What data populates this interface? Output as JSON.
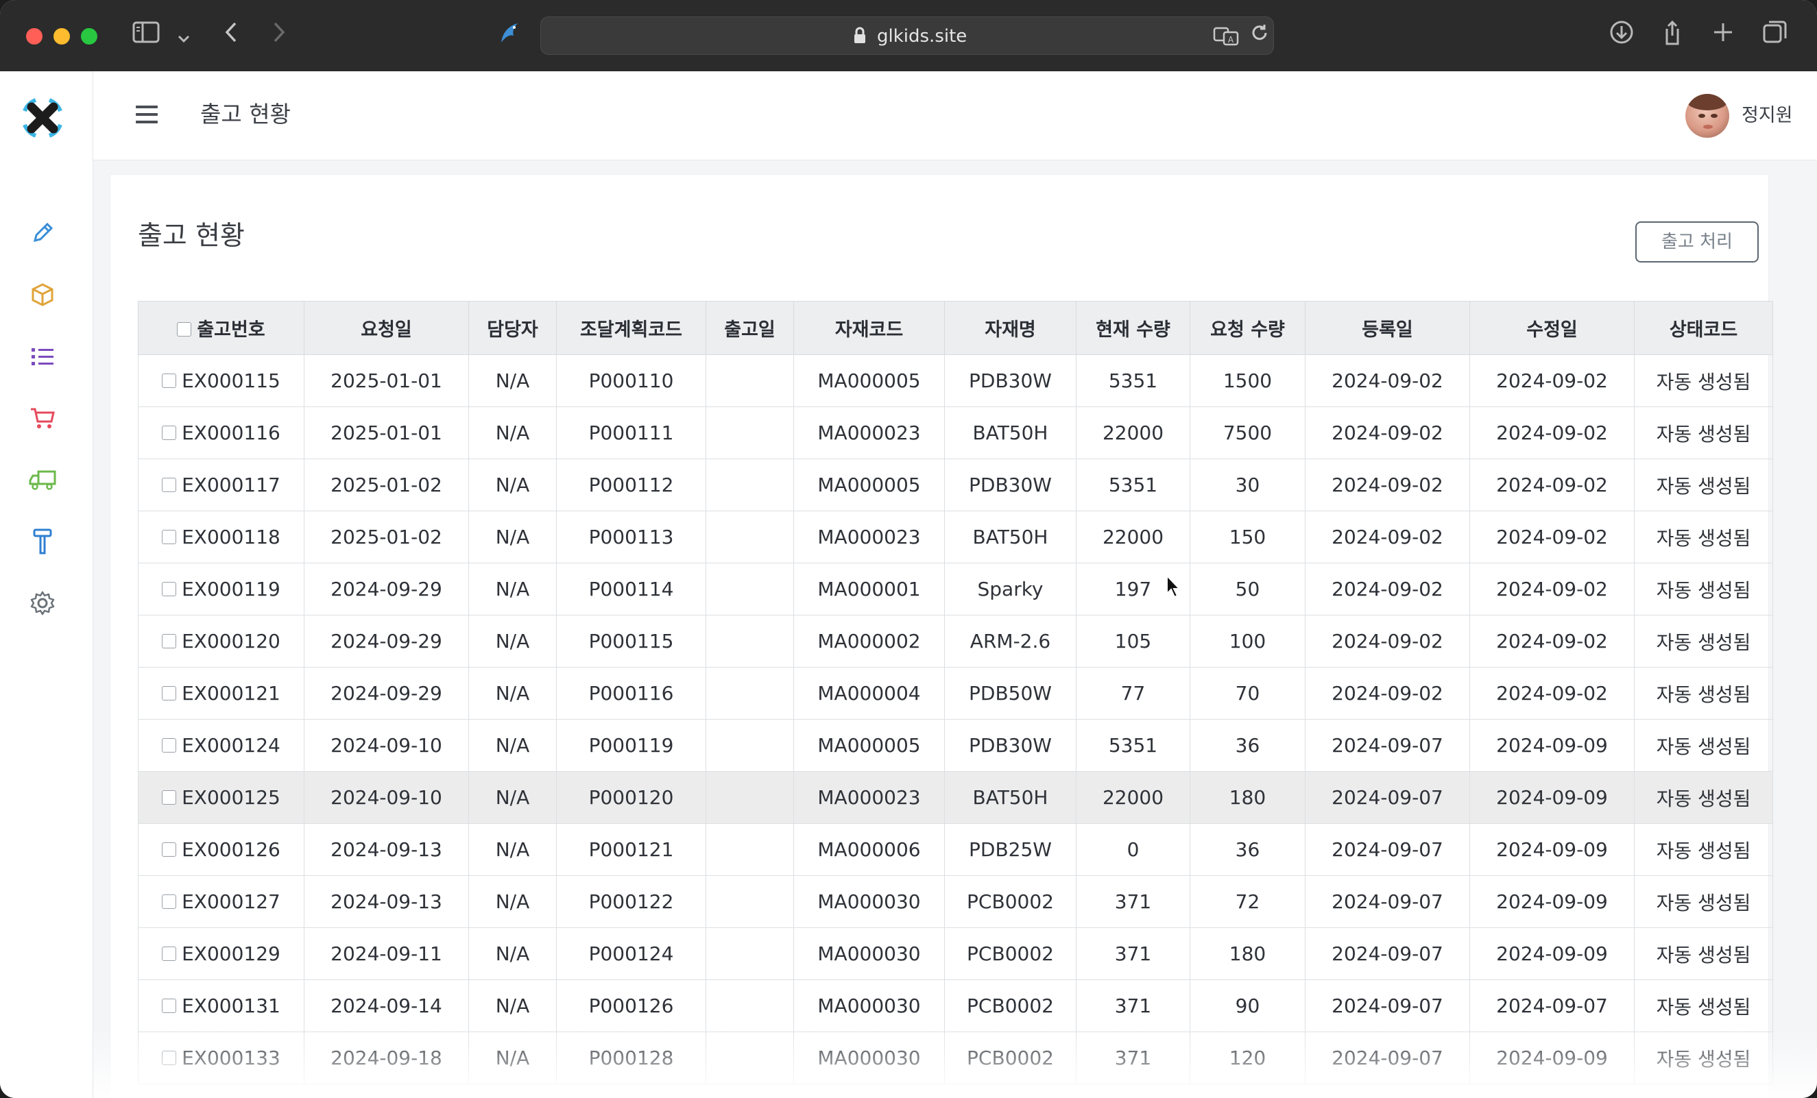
{
  "browser": {
    "url": "glkids.site",
    "icons": [
      "sidebar-toggle-icon",
      "chevron-down-icon",
      "back-icon",
      "forward-icon",
      "bird-icon",
      "lock-icon",
      "translate-icon",
      "reload-icon",
      "download-icon",
      "share-icon",
      "new-tab-icon",
      "tabs-overview-icon"
    ]
  },
  "app": {
    "top_title": "출고 현황",
    "user_name": "정지원",
    "sidebar_icons": [
      "pencil-icon",
      "box-icon",
      "list-icon",
      "cart-icon",
      "truck-icon",
      "hammer-icon",
      "gear-icon"
    ],
    "colors": {
      "pencil": "#3a8ed8",
      "box": "#e0a43a",
      "list": "#7b4bbd",
      "cart": "#e64a5c",
      "truck": "#6cb94c",
      "hammer": "#2f7fd1",
      "gear": "#6b7279"
    }
  },
  "page": {
    "title": "출고 현황",
    "action_button": "출고 처리"
  },
  "table": {
    "headers": [
      "출고번호",
      "요청일",
      "담당자",
      "조달계획코드",
      "출고일",
      "자재코드",
      "자재명",
      "현재 수량",
      "요청 수량",
      "등록일",
      "수정일",
      "상태코드"
    ],
    "rows": [
      [
        "EX000115",
        "2025-01-01",
        "N/A",
        "P000110",
        "",
        "MA000005",
        "PDB30W",
        "5351",
        "1500",
        "2024-09-02",
        "2024-09-02",
        "자동 생성됨"
      ],
      [
        "EX000116",
        "2025-01-01",
        "N/A",
        "P000111",
        "",
        "MA000023",
        "BAT50H",
        "22000",
        "7500",
        "2024-09-02",
        "2024-09-02",
        "자동 생성됨"
      ],
      [
        "EX000117",
        "2025-01-02",
        "N/A",
        "P000112",
        "",
        "MA000005",
        "PDB30W",
        "5351",
        "30",
        "2024-09-02",
        "2024-09-02",
        "자동 생성됨"
      ],
      [
        "EX000118",
        "2025-01-02",
        "N/A",
        "P000113",
        "",
        "MA000023",
        "BAT50H",
        "22000",
        "150",
        "2024-09-02",
        "2024-09-02",
        "자동 생성됨"
      ],
      [
        "EX000119",
        "2024-09-29",
        "N/A",
        "P000114",
        "",
        "MA000001",
        "Sparky",
        "197",
        "50",
        "2024-09-02",
        "2024-09-02",
        "자동 생성됨"
      ],
      [
        "EX000120",
        "2024-09-29",
        "N/A",
        "P000115",
        "",
        "MA000002",
        "ARM-2.6",
        "105",
        "100",
        "2024-09-02",
        "2024-09-02",
        "자동 생성됨"
      ],
      [
        "EX000121",
        "2024-09-29",
        "N/A",
        "P000116",
        "",
        "MA000004",
        "PDB50W",
        "77",
        "70",
        "2024-09-02",
        "2024-09-02",
        "자동 생성됨"
      ],
      [
        "EX000124",
        "2024-09-10",
        "N/A",
        "P000119",
        "",
        "MA000005",
        "PDB30W",
        "5351",
        "36",
        "2024-09-07",
        "2024-09-09",
        "자동 생성됨"
      ],
      [
        "EX000125",
        "2024-09-10",
        "N/A",
        "P000120",
        "",
        "MA000023",
        "BAT50H",
        "22000",
        "180",
        "2024-09-07",
        "2024-09-09",
        "자동 생성됨"
      ],
      [
        "EX000126",
        "2024-09-13",
        "N/A",
        "P000121",
        "",
        "MA000006",
        "PDB25W",
        "0",
        "36",
        "2024-09-07",
        "2024-09-09",
        "자동 생성됨"
      ],
      [
        "EX000127",
        "2024-09-13",
        "N/A",
        "P000122",
        "",
        "MA000030",
        "PCB0002",
        "371",
        "72",
        "2024-09-07",
        "2024-09-09",
        "자동 생성됨"
      ],
      [
        "EX000129",
        "2024-09-11",
        "N/A",
        "P000124",
        "",
        "MA000030",
        "PCB0002",
        "371",
        "180",
        "2024-09-07",
        "2024-09-09",
        "자동 생성됨"
      ],
      [
        "EX000131",
        "2024-09-14",
        "N/A",
        "P000126",
        "",
        "MA000030",
        "PCB0002",
        "371",
        "90",
        "2024-09-07",
        "2024-09-07",
        "자동 생성됨"
      ],
      [
        "EX000133",
        "2024-09-18",
        "N/A",
        "P000128",
        "",
        "MA000030",
        "PCB0002",
        "371",
        "120",
        "2024-09-07",
        "2024-09-09",
        "자동 생성됨"
      ]
    ]
  }
}
